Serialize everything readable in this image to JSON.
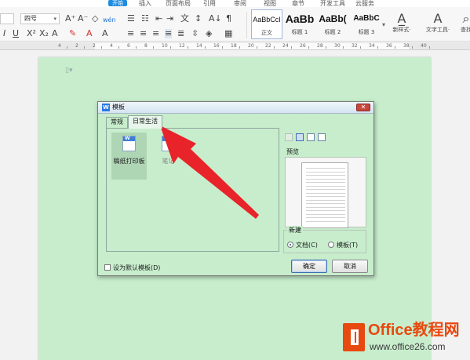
{
  "menu": {
    "items": [
      "开始",
      "插入",
      "页面布局",
      "引用",
      "审阅",
      "视图",
      "章节",
      "开发工具",
      "云服务"
    ],
    "active_index": 0
  },
  "toolbar": {
    "font_size_value": "四号",
    "font_size_arrow": "▾",
    "styles": [
      {
        "sample": "AaBbCcI",
        "caption": "正文"
      },
      {
        "sample": "AaBb",
        "caption": "标题 1"
      },
      {
        "sample": "AaBb(",
        "caption": "标题 2"
      },
      {
        "sample": "AaBbC",
        "caption": "标题 3"
      }
    ],
    "new_style_label": "新样式·",
    "text_tools_label": "文字工具·",
    "find_label": "查找"
  },
  "ruler": {
    "numbers": [
      "4",
      "2",
      "2",
      "4",
      "6",
      "8",
      "10",
      "12",
      "14",
      "16",
      "18",
      "20",
      "22",
      "24",
      "26",
      "28",
      "30",
      "32",
      "34",
      "36",
      "38",
      "40"
    ]
  },
  "dialog": {
    "title": "模板",
    "close_glyph": "✕",
    "tabs": [
      "常规",
      "日常生活"
    ],
    "active_tab_index": 1,
    "templates": [
      {
        "label": "稿纸打印板",
        "selected": true
      },
      {
        "label": "笔记",
        "selected": false
      }
    ],
    "preview_label": "预览",
    "new_group_label": "新建",
    "radio_document": "文档(C)",
    "radio_template": "模板(T)",
    "radio_selected": "document",
    "default_checkbox": "设为默认模板(D)",
    "ok_button": "确定",
    "cancel_button": "取消"
  },
  "watermark": {
    "name": "Office教程网",
    "url": "www.office26.com"
  },
  "colors": {
    "page_green": "#c7edcc",
    "accent_blue": "#1d8ce0",
    "arrow_red": "#e8232a",
    "watermark_orange": "#e8490f"
  }
}
